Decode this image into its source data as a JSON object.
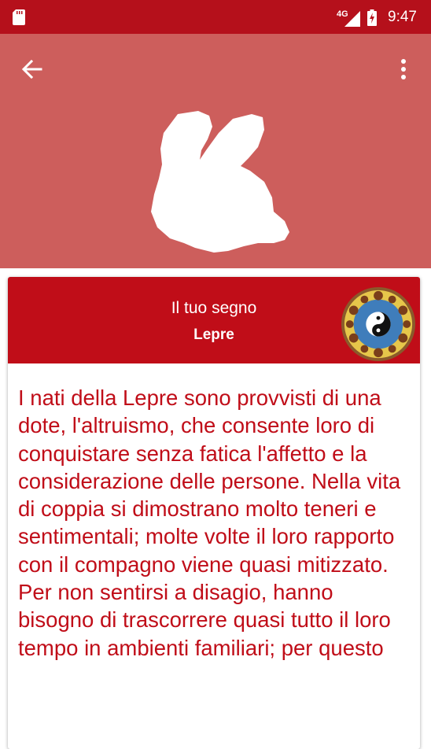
{
  "status_bar": {
    "network": "4G",
    "time": "9:47"
  },
  "toolbar": {
    "back_icon": "arrow-back-icon",
    "menu_icon": "more-vert-icon"
  },
  "header_image": {
    "icon": "rabbit-icon"
  },
  "card": {
    "label": "Il tuo segno",
    "sign": "Lepre",
    "wheel_icon": "chinese-zodiac-wheel-icon",
    "description": "I nati della Lepre sono provvisti di una dote, l'altruismo, che consente loro di conquistare senza fatica l'affetto e la considerazione delle persone. Nella vita di coppia si dimostrano molto teneri e sentimentali; molte volte il loro rapporto con il compagno viene quasi mitizzato. Per non sentirsi a disagio, hanno bisogno di trascorrere quasi tutto il loro tempo in ambienti familiari; per questo"
  },
  "colors": {
    "status_bar": "#b5101b",
    "app_bar": "#cd5e5c",
    "card_header": "#c00d18",
    "text_accent": "#c00d18"
  }
}
